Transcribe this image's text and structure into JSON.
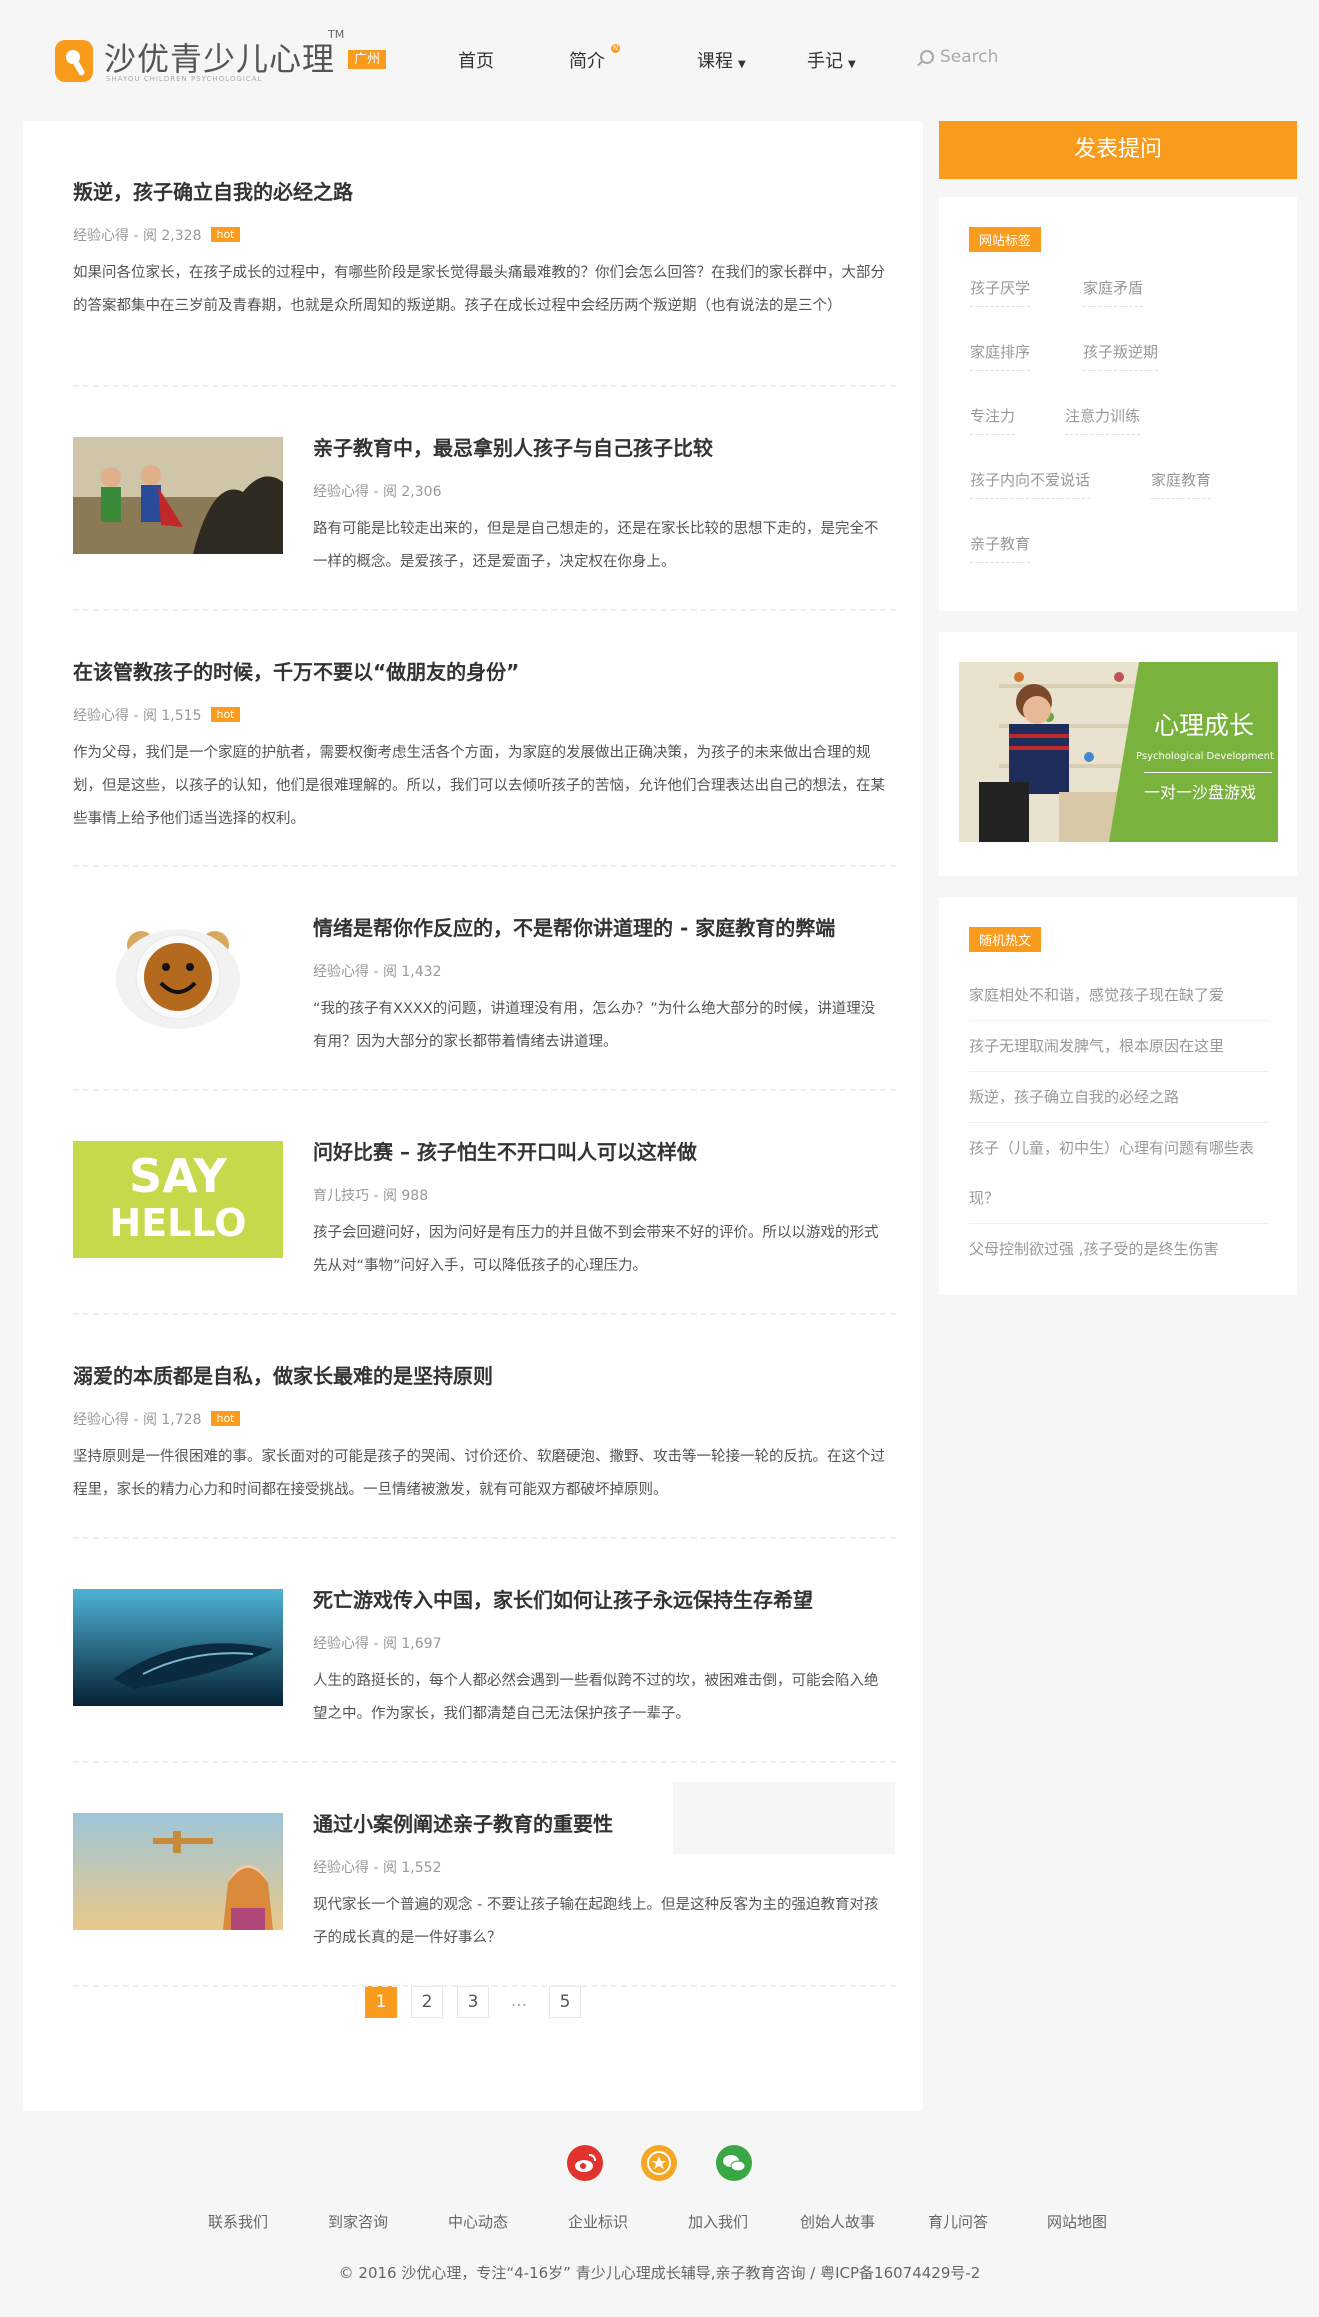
{
  "header": {
    "logo_text": "沙优青少儿心理",
    "logo_sub": "SHAYOU CHILDREN PSYCHOLOGICAL",
    "logo_tm": "TM",
    "city_badge": "广州",
    "nav": [
      {
        "label": "首页"
      },
      {
        "label": "简介",
        "badge": "N"
      },
      {
        "label": "课程",
        "caret": "▼"
      },
      {
        "label": "手记",
        "caret": "▼"
      }
    ],
    "search_placeholder": "Search"
  },
  "posts": [
    {
      "title": "叛逆，孩子确立自我的必经之路",
      "category": "经验心得",
      "views": "阅 2,328",
      "hot": "hot",
      "excerpt": "如果问各位家长，在孩子成长的过程中，有哪些阶段是家长觉得最头痛最难教的？你们会怎么回答？在我们的家长群中，大部分的答案都集中在三岁前及青春期，也就是众所周知的叛逆期。孩子在成长过程中会经历两个叛逆期（也有说法的是三个）"
    },
    {
      "title": "亲子教育中，最忌拿别人孩子与自己孩子比较",
      "category": "经验心得",
      "views": "阅 2,306",
      "excerpt": "路有可能是比较走出来的，但是是自己想走的，还是在家长比较的思想下走的，是完全不一样的概念。是爱孩子，还是爱面子，决定权在你身上。"
    },
    {
      "title": "在该管教孩子的时候，千万不要以“做朋友的身份”",
      "category": "经验心得",
      "views": "阅 1,515",
      "hot": "hot",
      "excerpt": "作为父母，我们是一个家庭的护航者，需要权衡考虑生活各个方面，为家庭的发展做出正确决策，为孩子的未来做出合理的规划，但是这些，以孩子的认知，他们是很难理解的。所以，我们可以去倾听孩子的苦恼，允许他们合理表达出自己的想法，在某些事情上给予他们适当选择的权利。"
    },
    {
      "title": "情绪是帮你作反应的，不是帮你讲道理的 - 家庭教育的弊端",
      "category": "经验心得",
      "views": "阅 1,432",
      "excerpt": "“我的孩子有XXXX的问题，讲道理没有用，怎么办？”为什么绝大部分的时候，讲道理没有用？因为大部分的家长都带着情绪去讲道理。"
    },
    {
      "title": "问好比赛 – 孩子怕生不开口叫人可以这样做",
      "category": "育儿技巧",
      "views": "阅 988",
      "excerpt": "孩子会回避问好，因为问好是有压力的并且做不到会带来不好的评价。所以以游戏的形式先从对“事物”问好入手，可以降低孩子的心理压力。",
      "thumb_text_1": "SAY",
      "thumb_text_2": "HELLO"
    },
    {
      "title": "溺爱的本质都是自私，做家长最难的是坚持原则",
      "category": "经验心得",
      "views": "阅 1,728",
      "hot": "hot",
      "excerpt": "坚持原则是一件很困难的事。家长面对的可能是孩子的哭闹、讨价还价、软磨硬泡、撒野、攻击等一轮接一轮的反抗。在这个过程里，家长的精力心力和时间都在接受挑战。一旦情绪被激发，就有可能双方都破坏掉原则。"
    },
    {
      "title": "死亡游戏传入中国，家长们如何让孩子永远保持生存希望",
      "category": "经验心得",
      "views": "阅 1,697",
      "excerpt": "人生的路挺长的，每个人都必然会遇到一些看似跨不过的坎，被困难击倒，可能会陷入绝望之中。作为家长，我们都清楚自己无法保护孩子一辈子。"
    },
    {
      "title": "通过小案例阐述亲子教育的重要性",
      "category": "经验心得",
      "views": "阅 1,552",
      "excerpt": "现代家长一个普遍的观念 - 不要让孩子输在起跑线上。但是这种反客为主的强迫教育对孩子的成长真的是一件好事么？"
    }
  ],
  "pagination": {
    "pages": [
      "1",
      "2",
      "3",
      "...",
      "5"
    ],
    "active": "1"
  },
  "sidebar": {
    "ask_button": "发表提问",
    "tags_title": "网站标签",
    "tags": [
      "孩子厌学",
      "家庭矛盾",
      "家庭排序",
      "孩子叛逆期",
      "专注力",
      "注意力训练",
      "孩子内向不爱说话",
      "家庭教育",
      "亲子教育"
    ],
    "banner": {
      "title": "心理成长",
      "subtitle": "Psychological Development",
      "caption": "一对一沙盘游戏"
    },
    "hot_title": "随机热文",
    "hot_posts": [
      "家庭相处不和谐，感觉孩子现在缺了爱",
      "孩子无理取闹发脾气，根本原因在这里",
      "叛逆，孩子确立自我的必经之路",
      "孩子（儿童，初中生）心理有问题有哪些表现？",
      "父母控制欲过强 ,孩子受的是终生伤害"
    ]
  },
  "footer": {
    "links": [
      "联系我们",
      "到家咨询",
      "中心动态",
      "企业标识",
      "加入我们",
      "创始人故事",
      "育儿问答",
      "网站地图"
    ],
    "copyright": "© 2016 沙优心理，专注“4-16岁” 青少儿心理成长辅导,亲子教育咨询 / 粤ICP备16074429号-2"
  },
  "colors": {
    "accent": "#f99b1c",
    "weibo": "#e0342d",
    "favorite": "#f5a623",
    "wechat": "#3aa744"
  }
}
